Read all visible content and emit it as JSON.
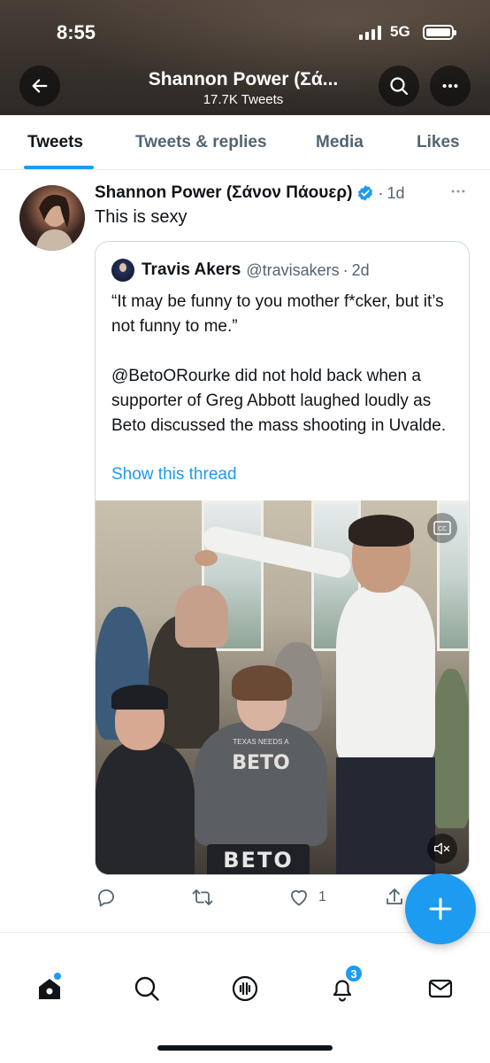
{
  "status_bar": {
    "time": "8:55",
    "network": "5G"
  },
  "header": {
    "title": "Shannon Power (Σά...",
    "subtitle": "17.7K Tweets",
    "background_color": "#3b332d"
  },
  "tabs": [
    {
      "label": "Tweets",
      "active": true
    },
    {
      "label": "Tweets & replies",
      "active": false
    },
    {
      "label": "Media",
      "active": false
    },
    {
      "label": "Likes",
      "active": false
    }
  ],
  "tweet": {
    "author": "Shannon Power (Σάνον Πάουερ)",
    "verified": true,
    "separator": "·",
    "age": "1d",
    "text": "This is sexy",
    "more_icon": "more-horizontal-icon",
    "quote": {
      "author": "Travis Akers",
      "handle": "@travisakers",
      "separator": "·",
      "age": "2d",
      "paragraphs": [
        "“It may be funny to you mother f*cker, but it’s not funny to me.”",
        "@BetoORourke did not hold back when a supporter of Greg Abbott laughed loudly as Beto discussed the mass shooting in Uvalde."
      ],
      "thread_link": "Show this thread",
      "video": {
        "shirt_small": "TEXAS NEEDS A",
        "shirt_big": "BETO",
        "sign_text": "BETO",
        "cc_icon": "closed-captions-icon",
        "mute_icon": "speaker-muted-icon"
      }
    },
    "actions": {
      "reply_count": "",
      "retweet_count": "",
      "like_count": "1",
      "share_count": ""
    }
  },
  "fab": {
    "icon": "plus-icon",
    "color": "#1d9bf0"
  },
  "bottom_nav": {
    "items": [
      "home-icon",
      "search-icon",
      "spaces-icon",
      "bell-icon",
      "mail-icon"
    ],
    "notifications_badge": "3"
  },
  "colors": {
    "accent": "#1d9bf0",
    "text": "#0f1419",
    "secondary": "#536471"
  }
}
